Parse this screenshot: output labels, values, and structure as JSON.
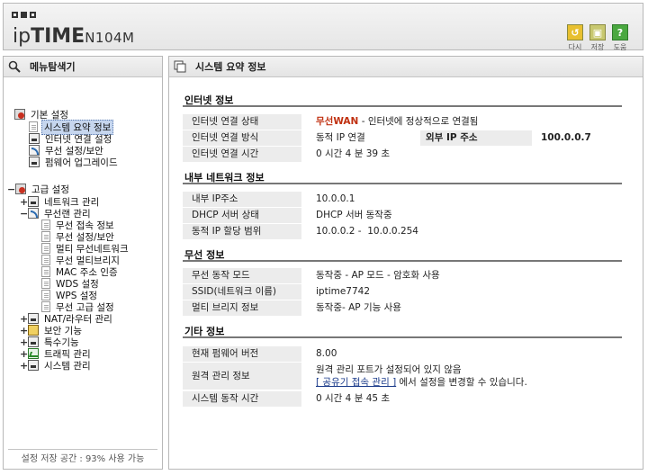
{
  "header": {
    "logo_light": "ip",
    "logo_bold": "TIME",
    "model": "N104M",
    "buttons": [
      {
        "label": "다시",
        "icon": "refresh-icon"
      },
      {
        "label": "저장",
        "icon": "save-icon"
      },
      {
        "label": "도움",
        "icon": "help-icon",
        "glyph": "?"
      }
    ]
  },
  "sidebar": {
    "title": "메뉴탐색기",
    "footer": "설정 저장 공간 : 93% 사용 가능",
    "basic_group": "기본 설정",
    "basic_items": [
      "시스템 요약 정보",
      "인터넷 연결 설정",
      "무선 설정/보안",
      "펌웨어 업그레이드"
    ],
    "advanced_group": "고급 설정",
    "network_mgmt": "네트워크 관리",
    "wireless_mgmt": "무선랜 관리",
    "wireless_items": [
      "무선 접속 정보",
      "무선 설정/보안",
      "멀티 무선네트워크",
      "무선 멀티브리지",
      "MAC 주소 인증",
      "WDS 설정",
      "WPS 설정",
      "무선 고급 설정"
    ],
    "other_groups": [
      "NAT/라우터 관리",
      "보안 기능",
      "특수기능",
      "트래픽 관리",
      "시스템 관리"
    ]
  },
  "main": {
    "title": "시스템 요약 정보",
    "internet": {
      "title": "인터넷 정보",
      "status_label": "인터넷 연결 상태",
      "status_value_strong": "무선WAN",
      "status_value_rest": " - 인터넷에 정상적으로 연결됨",
      "method_label": "인터넷 연결 방식",
      "method_value": "동적 IP 연결",
      "ext_ip_label": "외부 IP 주소",
      "ext_ip_value": "100.0.0.7",
      "time_label": "인터넷 연결 시간",
      "time_value": "0 시간 4 분 39 초"
    },
    "lan": {
      "title": "내부 네트워크 정보",
      "ip_label": "내부 IP주소",
      "ip_value": "10.0.0.1",
      "dhcp_label": "DHCP 서버 상태",
      "dhcp_value": "DHCP 서버 동작중",
      "range_label": "동적 IP 할당 범위",
      "range_value": "10.0.0.2 -  10.0.0.254"
    },
    "wireless": {
      "title": "무선 정보",
      "mode_label": "무선 동작 모드",
      "mode_value": "동작중 - AP 모드 - 암호화 사용",
      "ssid_label": "SSID(네트워크 이름)",
      "ssid_value": "iptime7742",
      "bridge_label": "멀티 브리지 정보",
      "bridge_value": "동작중- AP 기능 사용"
    },
    "etc": {
      "title": "기타 정보",
      "fw_label": "현재 펌웨어 버전",
      "fw_value": "8.00",
      "remote_label": "원격 관리 정보",
      "remote_line1": "원격 관리 포트가 설정되어 있지 않음",
      "remote_link": "[ 공유기 접속 관리 ]",
      "remote_line2_rest": " 에서 설정을 변경할 수 있습니다.",
      "uptime_label": "시스템 동작 시간",
      "uptime_value": "0 시간 4 분 45 초"
    }
  }
}
